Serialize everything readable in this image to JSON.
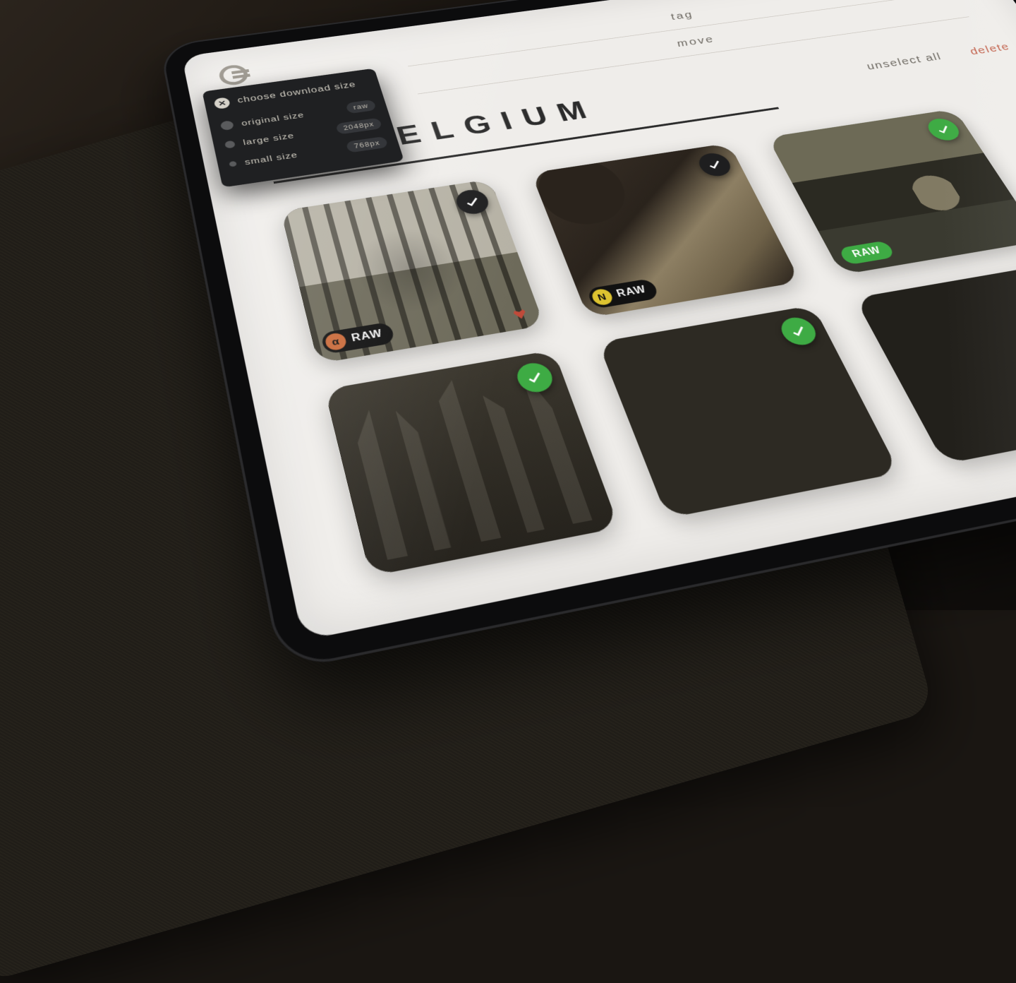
{
  "header": {
    "tag_label": "tag",
    "move_label": "move"
  },
  "actions": {
    "unselect_label": "unselect all",
    "delete_label": "delete"
  },
  "album": {
    "title": "TO BELGIUM"
  },
  "popover": {
    "title": "choose download size",
    "options": [
      {
        "label": "original size",
        "tag": "raw"
      },
      {
        "label": "large size",
        "tag": "2048px"
      },
      {
        "label": "small size",
        "tag": "768px"
      }
    ]
  },
  "raw_label": "RAW",
  "photos": [
    {
      "id": "canal",
      "raw": true,
      "badge_style": "dark",
      "chip": "α",
      "chip_style": "orange",
      "favorite": true
    },
    {
      "id": "letters",
      "raw": true,
      "badge_style": "dark",
      "chip": "N",
      "chip_style": "yellow",
      "favorite": false
    },
    {
      "id": "bridge",
      "raw": true,
      "badge_style": "green",
      "chip": null,
      "chip_style": "none",
      "favorite": false,
      "raw_green": true
    },
    {
      "id": "gothic",
      "raw": false,
      "badge_style": "green",
      "chip": null,
      "chip_style": "none",
      "favorite": false
    },
    {
      "id": "dark",
      "raw": false,
      "badge_style": "green",
      "chip": null,
      "chip_style": "none",
      "favorite": false
    },
    {
      "id": "dark2",
      "raw": false,
      "badge_style": null,
      "chip": null,
      "chip_style": "none",
      "favorite": false
    }
  ]
}
